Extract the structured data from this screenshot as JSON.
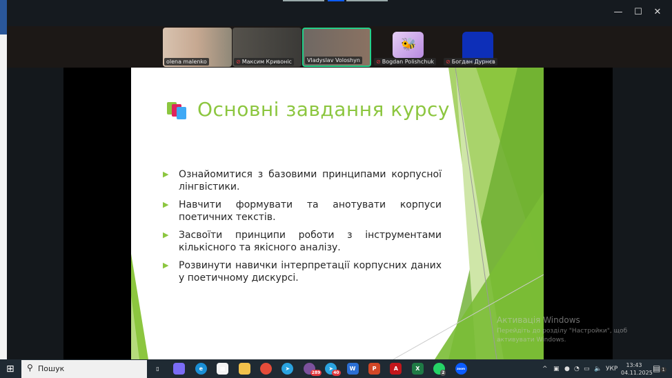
{
  "window": {
    "minimize": "—",
    "maximize": "☐",
    "close": "✕"
  },
  "participants": [
    {
      "name": "olena malenko",
      "muted": false,
      "color": "#c9b7a6"
    },
    {
      "name": "Максим Кривоніс",
      "muted": true,
      "color": "#4a4844"
    },
    {
      "name": "Vladyslav Voloshyn",
      "muted": false,
      "active": true,
      "color": "#6a5e56"
    },
    {
      "name": "Bogdan Polishchuk",
      "muted": true,
      "color": "#1c1816"
    },
    {
      "name": "Богдан Дурнєв",
      "muted": true,
      "color": "#1c1816"
    }
  ],
  "slide": {
    "title": "Основні завдання курсу",
    "bullets": [
      "Ознайомитися з базовими принципами корпусної лінгвістики.",
      "Навчити формувати та анотувати корпуси поетичних текстів.",
      "Засвоїти принципи роботи з інструментами кількісного та якісного аналізу.",
      "Розвинути навички інтерпретації корпусних даних у поетичному дискурсі."
    ],
    "accent": "#8cc63f"
  },
  "activation": {
    "title": "Активація Windows",
    "subtitle": "Перейдіть до розділу \"Настройки\", щоб активувати Windows."
  },
  "taskbar": {
    "search_placeholder": "Пошук",
    "apps": [
      {
        "name": "task-view",
        "label": "▯"
      },
      {
        "name": "copilot",
        "label": ""
      },
      {
        "name": "edge",
        "label": "e"
      },
      {
        "name": "store",
        "label": "▦"
      },
      {
        "name": "file-explorer",
        "label": ""
      },
      {
        "name": "chrome",
        "label": ""
      },
      {
        "name": "telegram",
        "label": "➤"
      },
      {
        "name": "viber",
        "label": "",
        "badge": "289"
      },
      {
        "name": "telegram-2",
        "label": "➤",
        "badge": "40"
      },
      {
        "name": "word",
        "label": "W"
      },
      {
        "name": "powerpoint",
        "label": "P"
      },
      {
        "name": "acrobat",
        "label": "A"
      },
      {
        "name": "excel",
        "label": "X"
      },
      {
        "name": "whatsapp",
        "label": "",
        "badge": "2"
      },
      {
        "name": "zoom",
        "label": "zoom"
      }
    ],
    "language": "УКР",
    "time": "13:43",
    "date": "04.11.2025",
    "notifications": "1"
  }
}
